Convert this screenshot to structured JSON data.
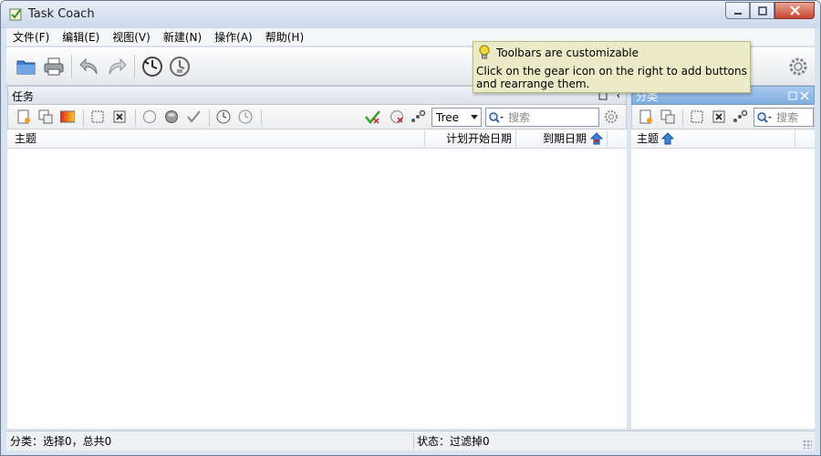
{
  "window": {
    "title": "Task Coach"
  },
  "menu": {
    "items": [
      "文件(F)",
      "编辑(E)",
      "视图(V)",
      "新建(N)",
      "操作(A)",
      "帮助(H)"
    ]
  },
  "toolbar": {
    "buttons": [
      "open-folder-icon",
      "print-icon",
      "undo-icon",
      "redo-icon",
      "start-timer-icon",
      "stop-timer-icon"
    ],
    "settings": "gear-icon"
  },
  "tooltip": {
    "title": "Toolbars are customizable",
    "body": "Click on the gear icon on the right to add buttons and rearrange them."
  },
  "tasks_panel": {
    "title": "任务",
    "view_mode": "Tree",
    "search_placeholder": "搜索",
    "columns": [
      "主题",
      "计划开始日期",
      "到期日期"
    ]
  },
  "categories_panel": {
    "title": "分类",
    "search_placeholder": "搜索",
    "columns": [
      "主题"
    ]
  },
  "status": {
    "left": "分类：选择0，总共0",
    "right": "状态：过滤掉0"
  },
  "colors": {
    "accent": "#7faedf",
    "tooltip_bg": "#ecebc8"
  }
}
